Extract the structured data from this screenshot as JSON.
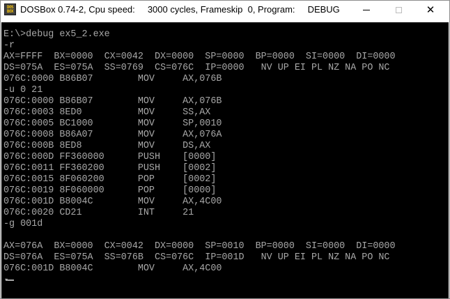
{
  "window": {
    "title": "DOSBox 0.74-2, Cpu speed:     3000 cycles, Frameskip  0, Program:     DEBUG",
    "icon": "dosbox-app-icon",
    "icon_text": [
      "DOS",
      "BOX"
    ],
    "controls": {
      "minimize": "minimize-icon",
      "maximize": "maximize-icon",
      "close": "close-icon",
      "close_glyph": "✕"
    }
  },
  "console": {
    "lines": [
      "E:\\>debug ex5_2.exe",
      "-r",
      "AX=FFFF  BX=0000  CX=0042  DX=0000  SP=0000  BP=0000  SI=0000  DI=0000",
      "DS=075A  ES=075A  SS=0769  CS=076C  IP=0000   NV UP EI PL NZ NA PO NC",
      "076C:0000 B86B07        MOV     AX,076B",
      "-u 0 21",
      "076C:0000 B86B07        MOV     AX,076B",
      "076C:0003 8ED0          MOV     SS,AX",
      "076C:0005 BC1000        MOV     SP,0010",
      "076C:0008 B86A07        MOV     AX,076A",
      "076C:000B 8ED8          MOV     DS,AX",
      "076C:000D FF360000      PUSH    [0000]",
      "076C:0011 FF360200      PUSH    [0002]",
      "076C:0015 8F060200      POP     [0002]",
      "076C:0019 8F060000      POP     [0000]",
      "076C:001D B8004C        MOV     AX,4C00",
      "076C:0020 CD21          INT     21",
      "-g 001d",
      "",
      "AX=076A  BX=0000  CX=0042  DX=0000  SP=0010  BP=0000  SI=0000  DI=0000",
      "DS=076A  ES=075A  SS=076B  CS=076C  IP=001D   NV UP EI PL NZ NA PO NC",
      "076C:001D B8004C        MOV     AX,4C00"
    ],
    "prompt": "-",
    "text_color": "#a8a8a8",
    "background_color": "#000000"
  }
}
